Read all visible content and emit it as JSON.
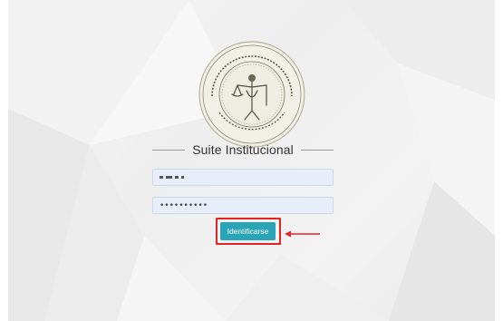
{
  "app": {
    "title": "Suite Institucional"
  },
  "seal": {
    "icon": "court-seal-icon",
    "text_top": "PODER JUDICIAL DEL ESTADO DE CAMPECHE",
    "text_bottom": "TRIBUNAL SUPERIOR DE JUSTICIA"
  },
  "form": {
    "username_value": "",
    "password_value": "••••••••••",
    "login_label": "Identificarse"
  },
  "annotation": {
    "highlight_color": "#e22424",
    "arrow_icon": "left-arrow-icon"
  },
  "colors": {
    "button": "#2aa5b8",
    "input_bg": "#e8eef9"
  }
}
